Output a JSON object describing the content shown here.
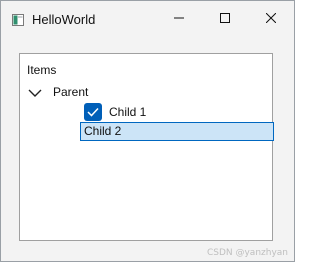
{
  "window": {
    "title": "HelloWorld",
    "icon": "app-window-icon",
    "controls": {
      "minimize_icon": "minimize-icon",
      "maximize_icon": "maximize-icon",
      "close_icon": "close-icon"
    }
  },
  "tree": {
    "header": "Items",
    "items": [
      {
        "label": "Parent",
        "expanded": true,
        "children": [
          {
            "label": "Child 1",
            "checked": true
          },
          {
            "label": "Child 2",
            "editing": true
          }
        ]
      }
    ]
  },
  "watermark": "CSDN @yanzhyan",
  "colors": {
    "accent": "#005fb8",
    "selection_bg": "#cce4f7",
    "selection_border": "#0067c0"
  }
}
